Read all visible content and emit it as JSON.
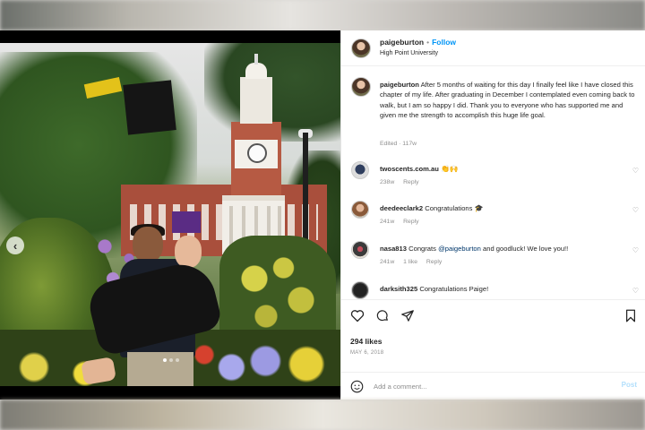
{
  "header": {
    "username": "paigeburton",
    "separator": "•",
    "follow_label": "Follow",
    "location": "High Point University",
    "more_icon": "more-icon"
  },
  "caption": {
    "username": "paigeburton",
    "text": "After 5 months of waiting for this day I finally feel like I have closed this chapter of my life. After graduating in December I contemplated even coming back to walk, but I am so happy I did. Thank you to everyone who has supported me and given me the strength to accomplish this huge life goal.",
    "meta": "Edited · 117w"
  },
  "comments": [
    {
      "username": "twoscents.com.au",
      "text": "",
      "emoji": "👏🙌",
      "time": "238w",
      "reply": "Reply",
      "likes": ""
    },
    {
      "username": "deedeeclark2",
      "text": "Congratulations",
      "emoji": "🎓",
      "time": "241w",
      "reply": "Reply",
      "likes": ""
    },
    {
      "username": "nasa813",
      "text_before": "Congrats",
      "mention": "@paigeburton",
      "text_after": "and goodluck! We love you!!",
      "time": "241w",
      "likes": "1 like",
      "reply": "Reply"
    },
    {
      "username": "darksith325",
      "text": "Congratulations Paige!",
      "time": "",
      "reply": "",
      "likes": ""
    }
  ],
  "actions": {
    "like_icon": "heart-icon",
    "comment_icon": "comment-icon",
    "share_icon": "share-icon",
    "save_icon": "bookmark-icon"
  },
  "likes": "294 likes",
  "date": "MAY 6, 2018",
  "add_comment": {
    "placeholder": "Add a comment...",
    "post_label": "Post"
  },
  "colors": {
    "link_blue": "#0095f6",
    "text": "#262626",
    "muted": "#8e8e8e"
  }
}
